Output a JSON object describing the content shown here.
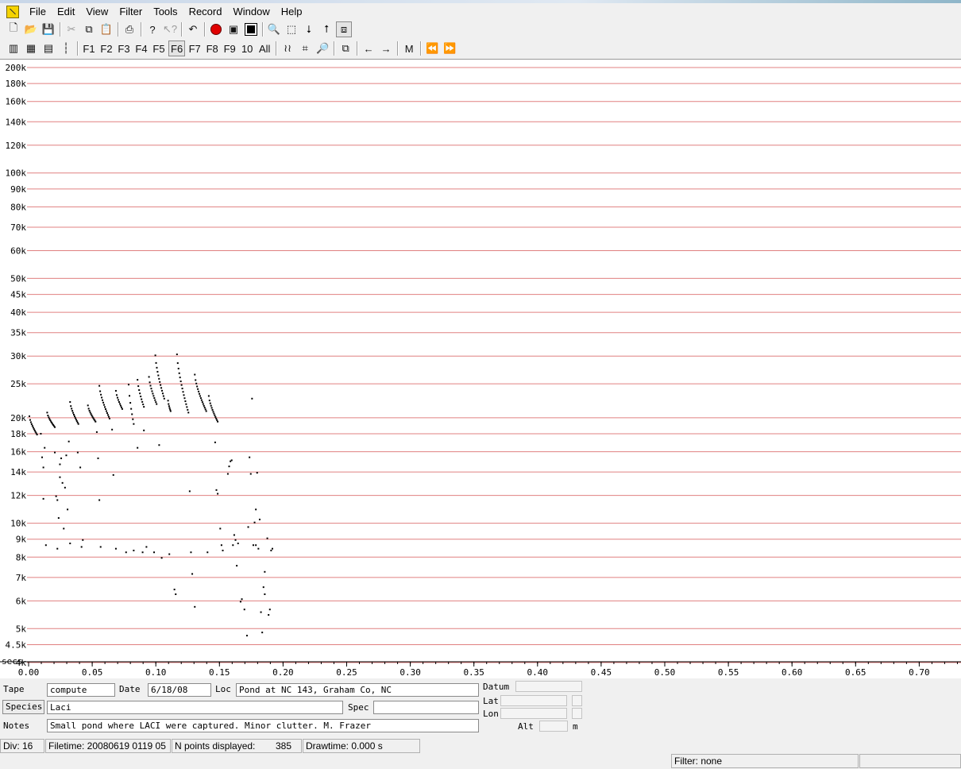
{
  "menu": [
    "File",
    "Edit",
    "View",
    "Filter",
    "Tools",
    "Record",
    "Window",
    "Help"
  ],
  "toolbar1": [
    {
      "name": "new-icon",
      "glyph": "🗋"
    },
    {
      "name": "open-icon",
      "glyph": "📂"
    },
    {
      "name": "save-icon",
      "glyph": "💾"
    },
    {
      "sep": true
    },
    {
      "name": "cut-icon",
      "glyph": "✂",
      "dim": true
    },
    {
      "name": "copy-icon",
      "glyph": "⧉"
    },
    {
      "name": "paste-icon",
      "glyph": "📋",
      "dim": true
    },
    {
      "sep": true
    },
    {
      "name": "print-icon",
      "glyph": "⎙"
    },
    {
      "sep": true
    },
    {
      "name": "help-icon",
      "glyph": "?"
    },
    {
      "name": "context-help-icon",
      "glyph": "↖?",
      "dim": true
    },
    {
      "sep": true
    },
    {
      "name": "undo-icon",
      "glyph": "↶"
    },
    {
      "sep": true
    },
    {
      "name": "record-icon",
      "glyph": "rec"
    },
    {
      "name": "monitor-icon",
      "glyph": "▣"
    },
    {
      "name": "stop-icon",
      "glyph": "sq"
    },
    {
      "sep": true
    },
    {
      "name": "zoom-icon",
      "glyph": "🔍"
    },
    {
      "name": "select-box-icon",
      "glyph": "⬚"
    },
    {
      "name": "arrow-down-icon",
      "glyph": "⭣"
    },
    {
      "name": "arrow-up-icon",
      "glyph": "⭡"
    },
    {
      "name": "layout-icon",
      "glyph": "⧈",
      "pressed": true
    }
  ],
  "toolbar2": [
    {
      "name": "view-compressed-icon",
      "glyph": "▥"
    },
    {
      "name": "view-realtime-icon",
      "glyph": "▦"
    },
    {
      "name": "view-gapped-icon",
      "glyph": "▤"
    },
    {
      "name": "view-dots-icon",
      "glyph": "┆"
    },
    {
      "sep": true
    },
    {
      "name": "f1-button",
      "text": "F1"
    },
    {
      "name": "f2-button",
      "text": "F2"
    },
    {
      "name": "f3-button",
      "text": "F3"
    },
    {
      "name": "f4-button",
      "text": "F4"
    },
    {
      "name": "f5-button",
      "text": "F5"
    },
    {
      "name": "f6-button",
      "text": "F6",
      "pressed": true
    },
    {
      "name": "f7-button",
      "text": "F7"
    },
    {
      "name": "f8-button",
      "text": "F8"
    },
    {
      "name": "f9-button",
      "text": "F9"
    },
    {
      "name": "f10-button",
      "text": "10"
    },
    {
      "name": "all-button",
      "text": "All"
    },
    {
      "sep": true
    },
    {
      "name": "curves-icon",
      "glyph": "≀≀"
    },
    {
      "name": "crosshair-icon",
      "glyph": "⌗"
    },
    {
      "name": "magnify-icon",
      "glyph": "🔎"
    },
    {
      "sep": true
    },
    {
      "name": "window-icon",
      "glyph": "⧉"
    },
    {
      "sep": true
    },
    {
      "name": "prev-icon",
      "glyph": "←"
    },
    {
      "name": "next-icon",
      "glyph": "→"
    },
    {
      "sep": true
    },
    {
      "name": "m-button",
      "text": "M"
    },
    {
      "sep": true
    },
    {
      "name": "fast-back-icon",
      "glyph": "⏪"
    },
    {
      "name": "fast-forward-icon",
      "glyph": "⏩"
    }
  ],
  "chart_data": {
    "type": "scatter",
    "x_unit_label": "secs",
    "y_scale": "log",
    "ylim": [
      3700,
      215000
    ],
    "xlim": [
      0,
      0.735
    ],
    "y_ticks": [
      {
        "v": 200000,
        "label": "200k"
      },
      {
        "v": 180000,
        "label": "180k"
      },
      {
        "v": 160000,
        "label": "160k"
      },
      {
        "v": 140000,
        "label": "140k"
      },
      {
        "v": 120000,
        "label": "120k"
      },
      {
        "v": 100000,
        "label": "100k"
      },
      {
        "v": 90000,
        "label": "90k"
      },
      {
        "v": 80000,
        "label": "80k"
      },
      {
        "v": 70000,
        "label": "70k"
      },
      {
        "v": 60000,
        "label": "60k"
      },
      {
        "v": 50000,
        "label": "50k"
      },
      {
        "v": 45000,
        "label": "45k"
      },
      {
        "v": 40000,
        "label": "40k"
      },
      {
        "v": 35000,
        "label": "35k"
      },
      {
        "v": 30000,
        "label": "30k"
      },
      {
        "v": 25000,
        "label": "25k"
      },
      {
        "v": 20000,
        "label": "20k"
      },
      {
        "v": 18000,
        "label": "18k"
      },
      {
        "v": 16000,
        "label": "16k"
      },
      {
        "v": 14000,
        "label": "14k"
      },
      {
        "v": 12000,
        "label": "12k"
      },
      {
        "v": 10000,
        "label": "10k"
      },
      {
        "v": 9000,
        "label": "9k"
      },
      {
        "v": 8000,
        "label": "8k"
      },
      {
        "v": 7000,
        "label": "7k"
      },
      {
        "v": 6000,
        "label": "6k"
      },
      {
        "v": 5000,
        "label": "5k"
      },
      {
        "v": 4500,
        "label": "4.5k"
      },
      {
        "v": 4000,
        "label": "4k"
      }
    ],
    "x_ticks": [
      {
        "v": 0.0,
        "label": "0.00"
      },
      {
        "v": 0.05,
        "label": "0.05"
      },
      {
        "v": 0.1,
        "label": "0.10"
      },
      {
        "v": 0.15,
        "label": "0.15"
      },
      {
        "v": 0.2,
        "label": "0.20"
      },
      {
        "v": 0.25,
        "label": "0.25"
      },
      {
        "v": 0.3,
        "label": "0.30"
      },
      {
        "v": 0.35,
        "label": "0.35"
      },
      {
        "v": 0.4,
        "label": "0.40"
      },
      {
        "v": 0.45,
        "label": "0.45"
      },
      {
        "v": 0.5,
        "label": "0.50"
      },
      {
        "v": 0.55,
        "label": "0.55"
      },
      {
        "v": 0.6,
        "label": "0.60"
      },
      {
        "v": 0.65,
        "label": "0.65"
      },
      {
        "v": 0.7,
        "label": "0.70"
      }
    ],
    "grid_color": "#e08080",
    "point_color": "#000000",
    "calls": [
      {
        "t0": 0.0,
        "dur": 0.006,
        "f0": 20300,
        "f1": 18000
      },
      {
        "t0": 0.014,
        "dur": 0.006,
        "f0": 20800,
        "f1": 18900
      },
      {
        "t0": 0.032,
        "dur": 0.0065,
        "f0": 22300,
        "f1": 19300
      },
      {
        "t0": 0.046,
        "dur": 0.006,
        "f0": 21800,
        "f1": 19600
      },
      {
        "t0": 0.055,
        "dur": 0.008,
        "f0": 24800,
        "f1": 20000
      },
      {
        "t0": 0.068,
        "dur": 0.005,
        "f0": 24000,
        "f1": 21300
      },
      {
        "t0": 0.078,
        "dur": 0.004,
        "f0": 25000,
        "f1": 19300
      },
      {
        "t0": 0.085,
        "dur": 0.005,
        "f0": 25800,
        "f1": 21600
      },
      {
        "t0": 0.094,
        "dur": 0.006,
        "f0": 26300,
        "f1": 22000
      },
      {
        "t0": 0.099,
        "dur": 0.007,
        "f0": 30300,
        "f1": 22800
      },
      {
        "t0": 0.109,
        "dur": 0.002,
        "f0": 22500,
        "f1": 21000
      },
      {
        "t0": 0.116,
        "dur": 0.009,
        "f0": 30500,
        "f1": 20800
      },
      {
        "t0": 0.13,
        "dur": 0.009,
        "f0": 26700,
        "f1": 21000
      },
      {
        "t0": 0.141,
        "dur": 0.007,
        "f0": 23200,
        "f1": 19600
      }
    ],
    "scatter": [
      [
        0.012,
        16500
      ],
      [
        0.009,
        18100
      ],
      [
        0.01,
        15500
      ],
      [
        0.011,
        14500
      ],
      [
        0.011,
        11800
      ],
      [
        0.013,
        8700
      ],
      [
        0.02,
        16000
      ],
      [
        0.021,
        12000
      ],
      [
        0.022,
        11700
      ],
      [
        0.023,
        10400
      ],
      [
        0.022,
        8500
      ],
      [
        0.024,
        13600
      ],
      [
        0.025,
        15400
      ],
      [
        0.026,
        13100
      ],
      [
        0.028,
        12700
      ],
      [
        0.029,
        15700
      ],
      [
        0.03,
        11000
      ],
      [
        0.032,
        8800
      ],
      [
        0.031,
        17200
      ],
      [
        0.027,
        9700
      ],
      [
        0.024,
        14800
      ],
      [
        0.038,
        16000
      ],
      [
        0.04,
        14500
      ],
      [
        0.042,
        9000
      ],
      [
        0.041,
        8600
      ],
      [
        0.053,
        18300
      ],
      [
        0.054,
        15400
      ],
      [
        0.055,
        11700
      ],
      [
        0.056,
        8600
      ],
      [
        0.065,
        18600
      ],
      [
        0.066,
        13800
      ],
      [
        0.068,
        8500
      ],
      [
        0.076,
        8300
      ],
      [
        0.082,
        8400
      ],
      [
        0.085,
        16500
      ],
      [
        0.089,
        8300
      ],
      [
        0.092,
        8600
      ],
      [
        0.09,
        18500
      ],
      [
        0.098,
        8300
      ],
      [
        0.102,
        16800
      ],
      [
        0.104,
        8000
      ],
      [
        0.11,
        8200
      ],
      [
        0.114,
        6500
      ],
      [
        0.115,
        6300
      ],
      [
        0.126,
        12400
      ],
      [
        0.127,
        8300
      ],
      [
        0.128,
        7200
      ],
      [
        0.13,
        5800
      ],
      [
        0.14,
        8300
      ],
      [
        0.146,
        17100
      ],
      [
        0.147,
        12500
      ],
      [
        0.148,
        12200
      ],
      [
        0.15,
        9700
      ],
      [
        0.151,
        8700
      ],
      [
        0.152,
        8400
      ],
      [
        0.156,
        13900
      ],
      [
        0.157,
        14600
      ],
      [
        0.158,
        15100
      ],
      [
        0.159,
        15200
      ],
      [
        0.16,
        8700
      ],
      [
        0.161,
        9300
      ],
      [
        0.162,
        9000
      ],
      [
        0.163,
        7600
      ],
      [
        0.164,
        8800
      ],
      [
        0.166,
        6000
      ],
      [
        0.167,
        6100
      ],
      [
        0.169,
        5700
      ],
      [
        0.171,
        4800
      ],
      [
        0.172,
        9800
      ],
      [
        0.173,
        15500
      ],
      [
        0.174,
        13900
      ],
      [
        0.175,
        22800
      ],
      [
        0.176,
        8700
      ],
      [
        0.177,
        10100
      ],
      [
        0.178,
        8700
      ],
      [
        0.178,
        11000
      ],
      [
        0.179,
        14000
      ],
      [
        0.18,
        8500
      ],
      [
        0.181,
        10300
      ],
      [
        0.182,
        5600
      ],
      [
        0.183,
        4900
      ],
      [
        0.184,
        6600
      ],
      [
        0.185,
        7300
      ],
      [
        0.185,
        6300
      ],
      [
        0.187,
        9100
      ],
      [
        0.188,
        5500
      ],
      [
        0.189,
        5700
      ],
      [
        0.19,
        8400
      ],
      [
        0.191,
        8500
      ]
    ]
  },
  "fields": {
    "tape_label": "Tape",
    "tape_value": "compute",
    "date_label": "Date",
    "date_value": "6/18/08",
    "loc_label": "Loc",
    "loc_value": "Pond at NC 143, Graham Co, NC",
    "datum_label": "Datum",
    "species_button": "Species",
    "species_value": "Laci",
    "spec_label": "Spec",
    "spec_value": "",
    "lat_label": "Lat",
    "lon_label": "Lon",
    "notes_label": "Notes",
    "notes_value": "Small pond where LACI were captured.  Minor clutter.  M. Frazer",
    "alt_label": "Alt",
    "alt_unit": "m"
  },
  "status": {
    "div": "Div: 16",
    "filetime": "Filetime: 20080619 0119 05",
    "npoints_label": "N points displayed:",
    "npoints_value": "385",
    "drawtime": "Drawtime: 0.000 s",
    "filter": "Filter: none"
  }
}
